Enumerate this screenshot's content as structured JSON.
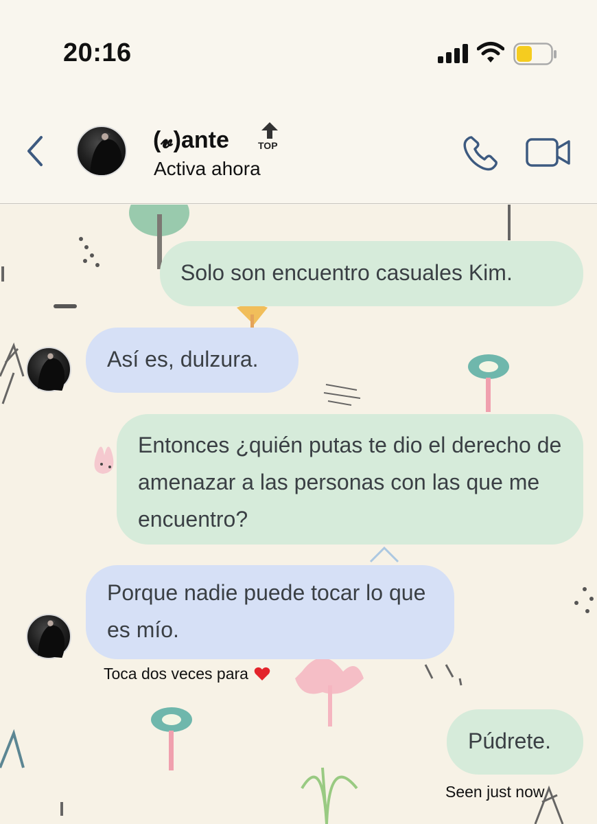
{
  "status_bar": {
    "time": "20:16",
    "signal_icon": "cellular-signal-icon",
    "wifi_icon": "wifi-icon",
    "battery_icon": "battery-icon",
    "battery_color": "#f5cc1f"
  },
  "header": {
    "back_icon": "chevron-left-icon",
    "contact_name": "(𝓿)ante",
    "top_badge": "TOP",
    "contact_status": "Activa ahora",
    "call_icon": "phone-icon",
    "video_icon": "video-camera-icon",
    "accent_color": "#3d5a80"
  },
  "messages": [
    {
      "direction": "outgoing",
      "text": "Solo son encuentro casuales Kim."
    },
    {
      "direction": "incoming",
      "text": "Así es, dulzura."
    },
    {
      "direction": "outgoing",
      "text": "Entonces ¿quién putas te dio el derecho de amenazar a las personas con las que me encuentro?"
    },
    {
      "direction": "incoming",
      "text": "Porque nadie puede tocar lo que es mío."
    },
    {
      "direction": "outgoing",
      "text": "Púdrete."
    }
  ],
  "reaction_hint": "Toca dos veces para",
  "reaction_icon": "heart-icon",
  "seen_status": "Seen just now",
  "colors": {
    "outgoing_bubble": "#d6ebda",
    "incoming_bubble": "#d6e0f6",
    "background": "#f7f2e6"
  }
}
